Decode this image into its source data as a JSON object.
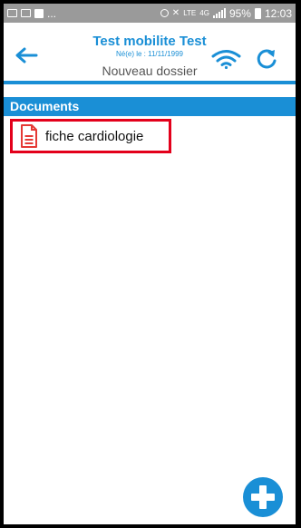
{
  "status_bar": {
    "notification_icons": [
      "image-icon",
      "photo-icon",
      "facebook-icon"
    ],
    "more": "...",
    "network_type": "LTE",
    "network_4g": "4G",
    "battery": "95%",
    "time": "12:03"
  },
  "header": {
    "title": "Test mobilite Test",
    "subtitle": "Né(e) le : 11/11/1999",
    "folder_label": "Nouveau dossier",
    "icons": [
      "back-arrow-icon",
      "wifi-icon",
      "refresh-icon"
    ]
  },
  "section": {
    "title": "Documents"
  },
  "documents": [
    {
      "label": "fiche cardiologie",
      "icon": "pdf-document-icon"
    }
  ],
  "fab": {
    "icon": "plus-icon"
  },
  "colors": {
    "accent": "#1a8fd6",
    "highlight_border": "#e3001b",
    "doc_icon": "#e53935",
    "status_bar": "#9a9a9a"
  }
}
